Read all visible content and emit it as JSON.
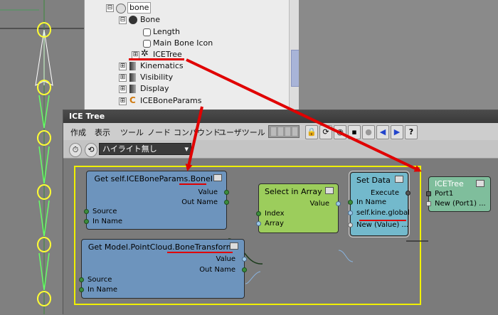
{
  "explorer": {
    "items": [
      {
        "label": "bone",
        "expander": "⊟"
      },
      {
        "label": "Bone",
        "expander": "⊟"
      },
      {
        "label": "Length",
        "expander": ""
      },
      {
        "label": "Main Bone Icon",
        "expander": ""
      },
      {
        "label": "ICETree",
        "expander": "⊞"
      },
      {
        "label": "Kinematics",
        "expander": "⊞"
      },
      {
        "label": "Visibility",
        "expander": "⊞"
      },
      {
        "label": "Display",
        "expander": "⊞"
      },
      {
        "label": "ICEBoneParams",
        "expander": "⊞"
      }
    ]
  },
  "icewindow": {
    "title": "ICE Tree",
    "menu": [
      "作成",
      "表示",
      "ツール",
      "ノード",
      "コンパウンド",
      "ユーザツール"
    ],
    "dropdown_value": "ハイライト無し"
  },
  "nodes": {
    "get_boneid": {
      "title_prefix": "Get self.ICEBoneParams.",
      "title_key": "BoneID",
      "value": "Value",
      "outname": "Out Name",
      "source": "Source",
      "inname": "In Name"
    },
    "get_bonetransforms": {
      "title_prefix": "Get Model.PointCloud.",
      "title_key": "BoneTransforms",
      "value": "Value",
      "outname": "Out Name",
      "source": "Source",
      "inname": "In Name"
    },
    "select_in_array": {
      "title": "Select in Array",
      "value": "Value",
      "index": "Index",
      "array": "Array"
    },
    "set_data": {
      "title": "Set Data",
      "execute": "Execute",
      "inname": "In Name",
      "target": "self.kine.global",
      "new": "New (Value) ..."
    },
    "icetree": {
      "title": "ICETree",
      "port1": "Port1",
      "new": "New (Port1) ..."
    }
  },
  "colors": {
    "accent_red": "#e00000",
    "highlight_yellow": "#f0f000",
    "get_node": "#6d94bd",
    "select_node": "#9ccd5c",
    "setdata_node": "#73b9cc",
    "icetree_node": "#7fbe9c"
  }
}
